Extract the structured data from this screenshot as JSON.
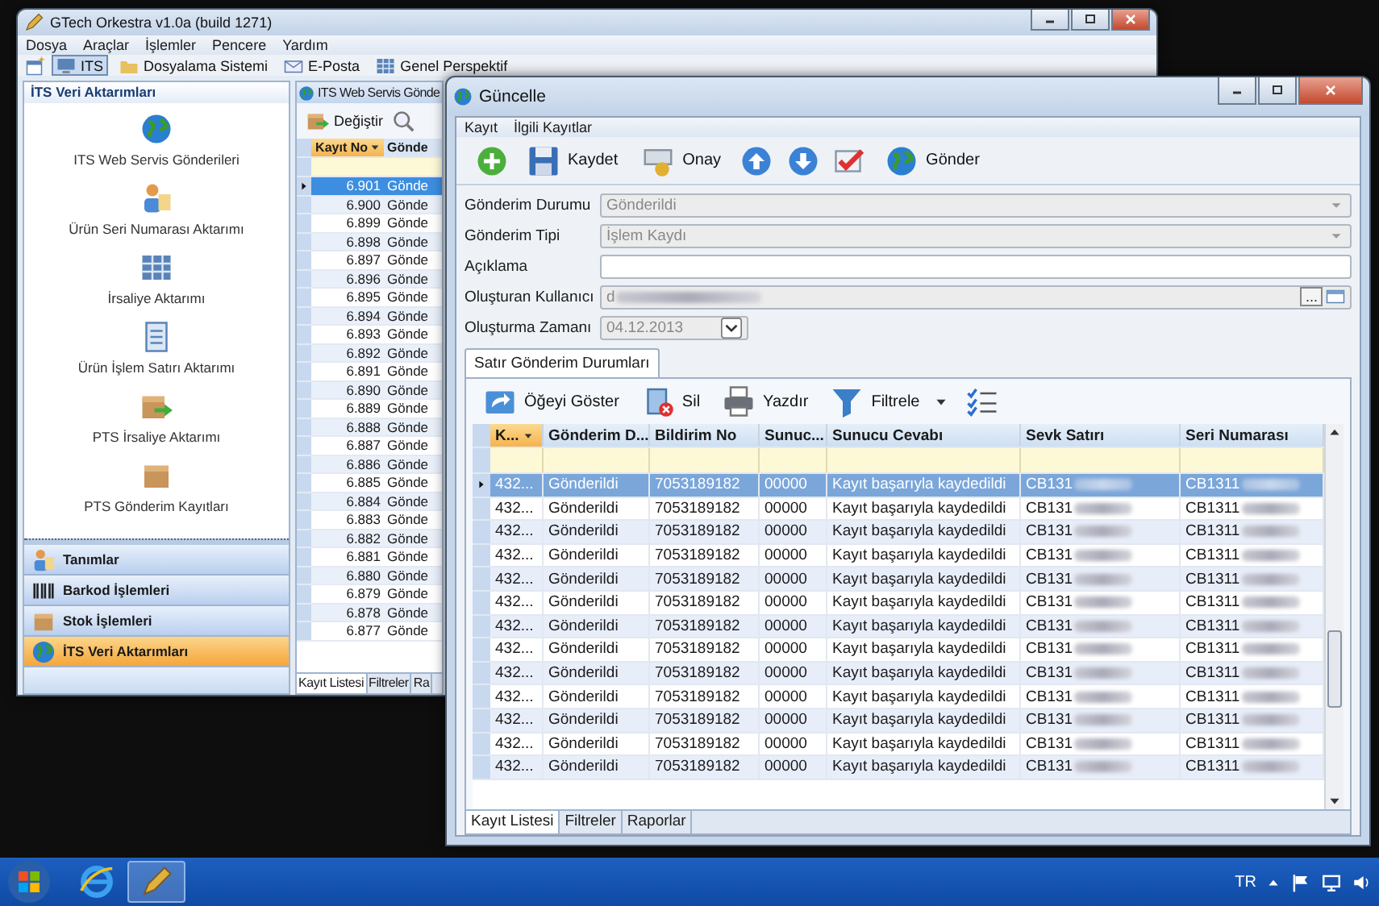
{
  "main_window": {
    "title": "GTech Orkestra v1.0a (build 1271)",
    "menu": [
      "Dosya",
      "Araçlar",
      "İşlemler",
      "Pencere",
      "Yardım"
    ],
    "toolbar": [
      {
        "label": "ITS",
        "selected": true
      },
      {
        "label": "Dosyalama Sistemi",
        "selected": false
      },
      {
        "label": "E-Posta",
        "selected": false
      },
      {
        "label": "Genel Perspektif",
        "selected": false
      }
    ],
    "sidebar": {
      "title": "İTS Veri Aktarımları",
      "items": [
        "ITS Web Servis Gönderileri",
        "Ürün Seri Numarası Aktarımı",
        "İrsaliye Aktarımı",
        "Ürün İşlem Satırı Aktarımı",
        "PTS İrsaliye Aktarımı",
        "PTS Gönderim Kayıtları"
      ],
      "groups": [
        {
          "label": "Tanımlar",
          "selected": false
        },
        {
          "label": "Barkod İşlemleri",
          "selected": false
        },
        {
          "label": "Stok İşlemleri",
          "selected": false
        },
        {
          "label": "İTS Veri Aktarımları",
          "selected": true
        }
      ]
    },
    "list_panel": {
      "title": "ITS Web Servis Gönde",
      "toolbar": [
        "Değiştir"
      ],
      "columns": [
        {
          "label": "Kayıt No",
          "sorted": true
        },
        {
          "label": "Gönde",
          "sorted": false
        }
      ],
      "rows": [
        {
          "kayit_no": "6.901",
          "column_2": "Gönde",
          "selected": true
        },
        {
          "kayit_no": "6.900",
          "column_2": "Gönde",
          "selected": false
        },
        {
          "kayit_no": "6.899",
          "column_2": "Gönde",
          "selected": false
        },
        {
          "kayit_no": "6.898",
          "column_2": "Gönde",
          "selected": false
        },
        {
          "kayit_no": "6.897",
          "column_2": "Gönde",
          "selected": false
        },
        {
          "kayit_no": "6.896",
          "column_2": "Gönde",
          "selected": false
        },
        {
          "kayit_no": "6.895",
          "column_2": "Gönde",
          "selected": false
        },
        {
          "kayit_no": "6.894",
          "column_2": "Gönde",
          "selected": false
        },
        {
          "kayit_no": "6.893",
          "column_2": "Gönde",
          "selected": false
        },
        {
          "kayit_no": "6.892",
          "column_2": "Gönde",
          "selected": false
        },
        {
          "kayit_no": "6.891",
          "column_2": "Gönde",
          "selected": false
        },
        {
          "kayit_no": "6.890",
          "column_2": "Gönde",
          "selected": false
        },
        {
          "kayit_no": "6.889",
          "column_2": "Gönde",
          "selected": false
        },
        {
          "kayit_no": "6.888",
          "column_2": "Gönde",
          "selected": false
        },
        {
          "kayit_no": "6.887",
          "column_2": "Gönde",
          "selected": false
        },
        {
          "kayit_no": "6.886",
          "column_2": "Gönde",
          "selected": false
        },
        {
          "kayit_no": "6.885",
          "column_2": "Gönde",
          "selected": false
        },
        {
          "kayit_no": "6.884",
          "column_2": "Gönde",
          "selected": false
        },
        {
          "kayit_no": "6.883",
          "column_2": "Gönde",
          "selected": false
        },
        {
          "kayit_no": "6.882",
          "column_2": "Gönde",
          "selected": false
        },
        {
          "kayit_no": "6.881",
          "column_2": "Gönde",
          "selected": false
        },
        {
          "kayit_no": "6.880",
          "column_2": "Gönde",
          "selected": false
        },
        {
          "kayit_no": "6.879",
          "column_2": "Gönde",
          "selected": false
        },
        {
          "kayit_no": "6.878",
          "column_2": "Gönde",
          "selected": false
        },
        {
          "kayit_no": "6.877",
          "column_2": "Gönde",
          "selected": false
        }
      ],
      "tabs": [
        {
          "label": "Kayıt Listesi",
          "selected": true
        },
        {
          "label": "Filtreler",
          "selected": false
        },
        {
          "label": "Ra",
          "selected": false
        }
      ]
    }
  },
  "dialog": {
    "title": "Güncelle",
    "menu": [
      "Kayıt",
      "İlgili Kayıtlar"
    ],
    "toolbar": [
      "Kaydet",
      "Onay",
      "Gönder"
    ],
    "fields": [
      {
        "label": "Gönderim Durumu",
        "kind": "combo",
        "value": "Gönderildi",
        "disabled": true
      },
      {
        "label": "Gönderim Tipi",
        "kind": "combo",
        "value": "İşlem Kaydı",
        "disabled": true
      },
      {
        "label": "Açıklama",
        "kind": "text",
        "disabled": false
      },
      {
        "label": "Oluşturan Kullanıcı",
        "kind": "lookup",
        "value": "d",
        "button_label": "...",
        "disabled": true
      },
      {
        "label": "Oluşturma Zamanı",
        "kind": "date",
        "value": "04.12.2013",
        "disabled": true
      }
    ],
    "tab": {
      "label": "Satır Gönderim Durumları",
      "selected": true
    },
    "grid_toolbar": [
      {
        "label": "Öğeyi Göster",
        "dropdown": false
      },
      {
        "label": "Sil",
        "dropdown": false
      },
      {
        "label": "Yazdır",
        "dropdown": false
      },
      {
        "label": "Filtrele",
        "dropdown": true
      }
    ],
    "columns": [
      {
        "label": "K...",
        "sorted": true
      },
      {
        "label": "Gönderim D...",
        "sorted": false
      },
      {
        "label": "Bildirim No",
        "sorted": false
      },
      {
        "label": "Sunuc...",
        "sorted": false
      },
      {
        "label": "Sunucu Cevabı",
        "sorted": false
      },
      {
        "label": "Sevk Satırı",
        "sorted": false
      },
      {
        "label": "Seri Numarası",
        "sorted": false
      }
    ],
    "rows": [
      {
        "selected": true,
        "cells": [
          "432...",
          "Gönderildi",
          "7053189182",
          "00000",
          "Kayıt başarıyla kaydedildi",
          "CB131",
          "CB1311"
        ]
      },
      {
        "selected": false,
        "cells": [
          "432...",
          "Gönderildi",
          "7053189182",
          "00000",
          "Kayıt başarıyla kaydedildi",
          "CB131",
          "CB1311"
        ]
      },
      {
        "selected": false,
        "cells": [
          "432...",
          "Gönderildi",
          "7053189182",
          "00000",
          "Kayıt başarıyla kaydedildi",
          "CB131",
          "CB1311"
        ]
      },
      {
        "selected": false,
        "cells": [
          "432...",
          "Gönderildi",
          "7053189182",
          "00000",
          "Kayıt başarıyla kaydedildi",
          "CB131",
          "CB1311"
        ]
      },
      {
        "selected": false,
        "cells": [
          "432...",
          "Gönderildi",
          "7053189182",
          "00000",
          "Kayıt başarıyla kaydedildi",
          "CB131",
          "CB1311"
        ]
      },
      {
        "selected": false,
        "cells": [
          "432...",
          "Gönderildi",
          "7053189182",
          "00000",
          "Kayıt başarıyla kaydedildi",
          "CB131",
          "CB1311"
        ]
      },
      {
        "selected": false,
        "cells": [
          "432...",
          "Gönderildi",
          "7053189182",
          "00000",
          "Kayıt başarıyla kaydedildi",
          "CB131",
          "CB1311"
        ]
      },
      {
        "selected": false,
        "cells": [
          "432...",
          "Gönderildi",
          "7053189182",
          "00000",
          "Kayıt başarıyla kaydedildi",
          "CB131",
          "CB1311"
        ]
      },
      {
        "selected": false,
        "cells": [
          "432...",
          "Gönderildi",
          "7053189182",
          "00000",
          "Kayıt başarıyla kaydedildi",
          "CB131",
          "CB1311"
        ]
      },
      {
        "selected": false,
        "cells": [
          "432...",
          "Gönderildi",
          "7053189182",
          "00000",
          "Kayıt başarıyla kaydedildi",
          "CB131",
          "CB1311"
        ]
      },
      {
        "selected": false,
        "cells": [
          "432...",
          "Gönderildi",
          "7053189182",
          "00000",
          "Kayıt başarıyla kaydedildi",
          "CB131",
          "CB1311"
        ]
      },
      {
        "selected": false,
        "cells": [
          "432...",
          "Gönderildi",
          "7053189182",
          "00000",
          "Kayıt başarıyla kaydedildi",
          "CB131",
          "CB1311"
        ]
      },
      {
        "selected": false,
        "cells": [
          "432...",
          "Gönderildi",
          "7053189182",
          "00000",
          "Kayıt başarıyla kaydedildi",
          "CB131",
          "CB1311"
        ]
      }
    ],
    "tabs": [
      {
        "label": "Kayıt Listesi",
        "selected": true
      },
      {
        "label": "Filtreler",
        "selected": false
      },
      {
        "label": "Raporlar",
        "selected": false
      }
    ]
  },
  "taskbar": {
    "language": "TR"
  }
}
